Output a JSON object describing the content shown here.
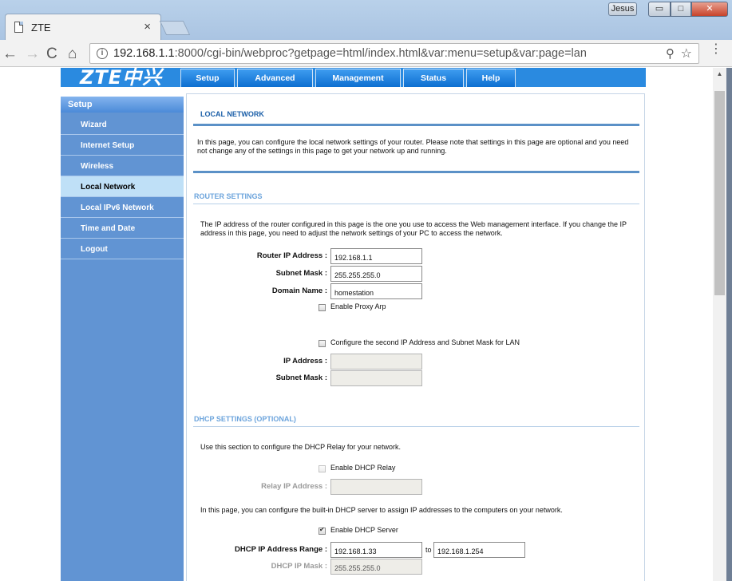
{
  "browser": {
    "tab_title": "ZTE",
    "tab_close": "×",
    "user": "Jesus",
    "url_host": "192.168.1.1",
    "url_path": ":8000/cgi-bin/webproc?getpage=html/index.html&var:menu=setup&var:page=lan",
    "icons": {
      "back": "←",
      "forward": "→",
      "reload": "C",
      "home": "⌂",
      "info": "i",
      "zoom": "⚲",
      "star": "☆",
      "menu": "⋮",
      "minimize": "▭",
      "maximize": "□",
      "close": "✕",
      "scroll_up": "▲"
    }
  },
  "header": {
    "logo": "ZTE中兴",
    "tabs": [
      "Setup",
      "Advanced",
      "Management",
      "Status",
      "Help"
    ]
  },
  "sidebar": {
    "title": "Setup",
    "items": [
      "Wizard",
      "Internet Setup",
      "Wireless",
      "Local Network",
      "Local IPv6 Network",
      "Time and Date",
      "Logout"
    ],
    "active": "Local Network"
  },
  "local_network": {
    "title": "LOCAL NETWORK",
    "intro": "In this page, you can configure the local network settings of your router. Please note that settings in this page are optional and you need not change any of the settings in this page to get your network up and running."
  },
  "router_settings": {
    "title": "ROUTER SETTINGS",
    "intro": "The IP address of the router configured in this page is the one you use to access the Web management interface. If you change the IP address in this page, you need to adjust the network settings of your PC to access the network.",
    "router_ip_label": "Router IP Address :",
    "router_ip_value": "192.168.1.1",
    "subnet_label": "Subnet Mask :",
    "subnet_value": "255.255.255.0",
    "domain_label": "Domain Name :",
    "domain_value": "homestation",
    "proxy_arp_label": "Enable Proxy Arp",
    "second_ip_label": "Configure the second IP Address and Subnet Mask for LAN",
    "ip2_label": "IP Address :",
    "subnet2_label": "Subnet Mask :"
  },
  "dhcp_settings": {
    "title": "DHCP SETTINGS (OPTIONAL)",
    "relay_intro": "Use this section to configure the DHCP Relay for your network.",
    "relay_enable_label": "Enable DHCP Relay",
    "relay_ip_label": "Relay IP Address :",
    "server_intro": "In this page, you can configure the built-in DHCP server to assign IP addresses to the computers on your network.",
    "server_enable_label": "Enable DHCP Server",
    "range_label": "DHCP IP Address Range :",
    "range_start": "192.168.1.33",
    "range_to": "to",
    "range_end": "192.168.1.254",
    "mask_label": "DHCP IP Mask :",
    "mask_value": "255.255.255.0"
  }
}
